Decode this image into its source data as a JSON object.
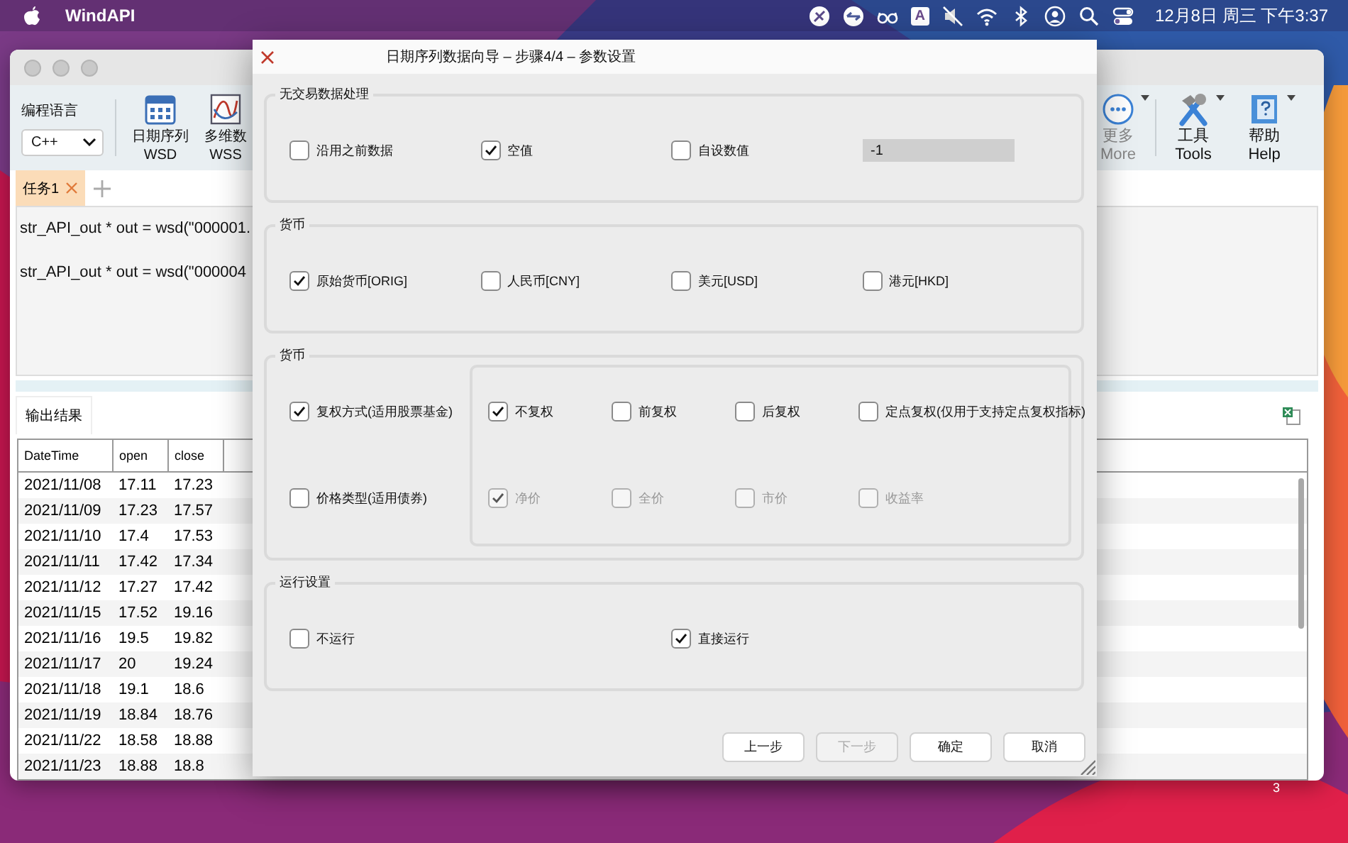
{
  "menubar": {
    "app": "WindAPI",
    "input_source": "A",
    "clock": "12月8日 周三 下午3:37"
  },
  "window": {
    "toolbar": {
      "language_label": "编程语言",
      "language": "C++",
      "left_buttons": [
        {
          "kind": "calendar",
          "label": "日期序列",
          "sublabel": "WSD",
          "disabled": false,
          "dropdown": false
        },
        {
          "kind": "chart",
          "label": "多维数",
          "sublabel": "WSS",
          "disabled": false,
          "dropdown": false
        }
      ],
      "right_buttons": [
        {
          "kind": "more",
          "label": "更多",
          "sublabel": "More",
          "disabled": true,
          "dropdown": true
        },
        {
          "kind": "tools",
          "label": "工具",
          "sublabel": "Tools",
          "disabled": false,
          "dropdown": true
        },
        {
          "kind": "help",
          "label": "帮助",
          "sublabel": "Help",
          "disabled": false,
          "dropdown": true
        }
      ]
    },
    "tabs": [
      {
        "label": "任务1",
        "selected": true
      }
    ],
    "code_lines": [
      "str_API_out * out = wsd(\"000001.",
      "str_API_out * out = wsd(\"000004"
    ],
    "output_tab": "输出结果",
    "table": {
      "columns": [
        "DateTime",
        "open",
        "close"
      ],
      "rows": [
        [
          "2021/11/08",
          "17.11",
          "17.23"
        ],
        [
          "2021/11/09",
          "17.23",
          "17.57"
        ],
        [
          "2021/11/10",
          "17.4",
          "17.53"
        ],
        [
          "2021/11/11",
          "17.42",
          "17.34"
        ],
        [
          "2021/11/12",
          "17.27",
          "17.42"
        ],
        [
          "2021/11/15",
          "17.52",
          "19.16"
        ],
        [
          "2021/11/16",
          "19.5",
          "19.82"
        ],
        [
          "2021/11/17",
          "20",
          "19.24"
        ],
        [
          "2021/11/18",
          "19.1",
          "18.6"
        ],
        [
          "2021/11/19",
          "18.84",
          "18.76"
        ],
        [
          "2021/11/22",
          "18.58",
          "18.88"
        ],
        [
          "2021/11/23",
          "18.88",
          "18.8"
        ]
      ]
    }
  },
  "dialog": {
    "title": "日期序列数据向导 – 步骤4/4 – 参数设置",
    "groups": [
      {
        "kind": "row",
        "title": "无交易数据处理",
        "options": [
          {
            "label": "沿用之前数据",
            "checked": false,
            "disabled": false
          },
          {
            "label": "空值",
            "checked": true,
            "disabled": false
          },
          {
            "label": "自设数值",
            "checked": false,
            "disabled": false
          }
        ],
        "field": {
          "value": "-1"
        }
      },
      {
        "kind": "row",
        "title": "货币",
        "options": [
          {
            "label": "原始货币[ORIG]",
            "checked": true,
            "disabled": false
          },
          {
            "label": "人民币[CNY]",
            "checked": false,
            "disabled": false
          },
          {
            "label": "美元[USD]",
            "checked": false,
            "disabled": false
          },
          {
            "label": "港元[HKD]",
            "checked": false,
            "disabled": false
          }
        ]
      },
      {
        "kind": "split",
        "title": "货币",
        "rows": [
          {
            "option": {
              "label": "复权方式(适用股票基金)",
              "checked": true,
              "disabled": false
            },
            "choices": [
              {
                "label": "不复权",
                "checked": true,
                "disabled": false
              },
              {
                "label": "前复权",
                "checked": false,
                "disabled": false
              },
              {
                "label": "后复权",
                "checked": false,
                "disabled": false
              },
              {
                "label": "定点复权(仅用于支持定点复权指标)",
                "checked": false,
                "disabled": false
              }
            ]
          },
          {
            "option": {
              "label": "价格类型(适用债券)",
              "checked": false,
              "disabled": false
            },
            "choices": [
              {
                "label": "净价",
                "checked": true,
                "disabled": true
              },
              {
                "label": "全价",
                "checked": false,
                "disabled": true
              },
              {
                "label": "市价",
                "checked": false,
                "disabled": true
              },
              {
                "label": "收益率",
                "checked": false,
                "disabled": true
              }
            ]
          }
        ]
      },
      {
        "kind": "row",
        "title": "运行设置",
        "options": [
          {
            "label": "不运行",
            "checked": false,
            "disabled": false
          },
          {
            "label": "直接运行",
            "checked": true,
            "disabled": false
          }
        ]
      }
    ],
    "buttons": [
      {
        "label": "上一步",
        "disabled": false
      },
      {
        "label": "下一步",
        "disabled": true
      },
      {
        "label": "确定",
        "disabled": false
      },
      {
        "label": "取消",
        "disabled": false
      }
    ]
  },
  "desktop_label": "3"
}
